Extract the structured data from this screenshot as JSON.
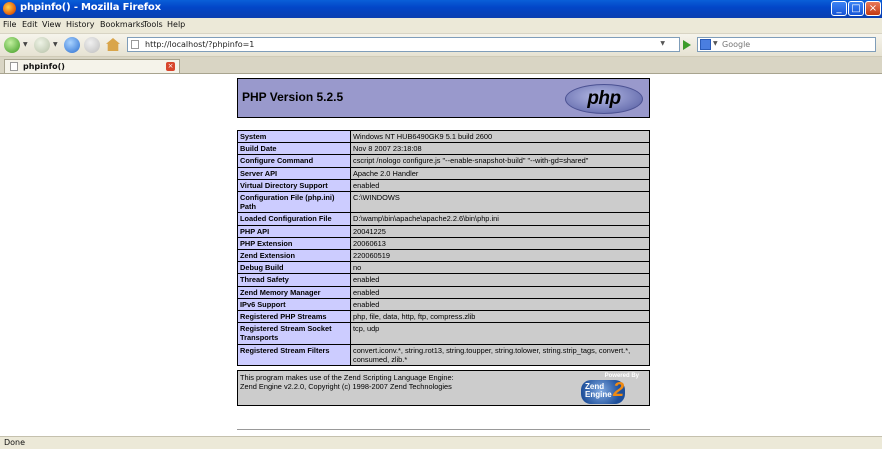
{
  "window": {
    "title": "phpinfo() - Mozilla Firefox"
  },
  "menu": [
    "File",
    "Edit",
    "View",
    "History",
    "Bookmarks",
    "Tools",
    "Help"
  ],
  "nav": {
    "url": "http://localhost/?phpinfo=1",
    "search_placeholder": "Google"
  },
  "tab": {
    "label": "phpinfo()"
  },
  "php": {
    "version_title": "PHP Version 5.2.5",
    "logo_text": "php",
    "rows": [
      [
        "System",
        "Windows NT HUB6490GK9 5.1 build 2600"
      ],
      [
        "Build Date",
        "Nov 8 2007 23:18:08"
      ],
      [
        "Configure Command",
        "cscript /nologo configure.js \"--enable-snapshot-build\" \"--with-gd=shared\""
      ],
      [
        "Server API",
        "Apache 2.0 Handler"
      ],
      [
        "Virtual Directory Support",
        "enabled"
      ],
      [
        "Configuration File (php.ini) Path",
        "C:\\WINDOWS"
      ],
      [
        "Loaded Configuration File",
        "D:\\wamp\\bin\\apache\\apache2.2.6\\bin\\php.ini"
      ],
      [
        "PHP API",
        "20041225"
      ],
      [
        "PHP Extension",
        "20060613"
      ],
      [
        "Zend Extension",
        "220060519"
      ],
      [
        "Debug Build",
        "no"
      ],
      [
        "Thread Safety",
        "enabled"
      ],
      [
        "Zend Memory Manager",
        "enabled"
      ],
      [
        "IPv6 Support",
        "enabled"
      ],
      [
        "Registered PHP Streams",
        "php, file, data, http, ftp, compress.zlib"
      ],
      [
        "Registered Stream Socket Transports",
        "tcp, udp"
      ],
      [
        "Registered Stream Filters",
        "convert.iconv.*, string.rot13, string.toupper, string.tolower, string.strip_tags, convert.*, consumed, zlib.*"
      ]
    ],
    "zend_line1": "This program makes use of the Zend Scripting Language Engine:",
    "zend_line2": "Zend Engine v2.2.0, Copyright (c) 1998-2007 Zend Technologies",
    "zend_logo": {
      "powered_by": "Powered By",
      "line1": "Zend",
      "line2": "Engine",
      "two": "2"
    }
  },
  "status": {
    "text": "Done"
  }
}
